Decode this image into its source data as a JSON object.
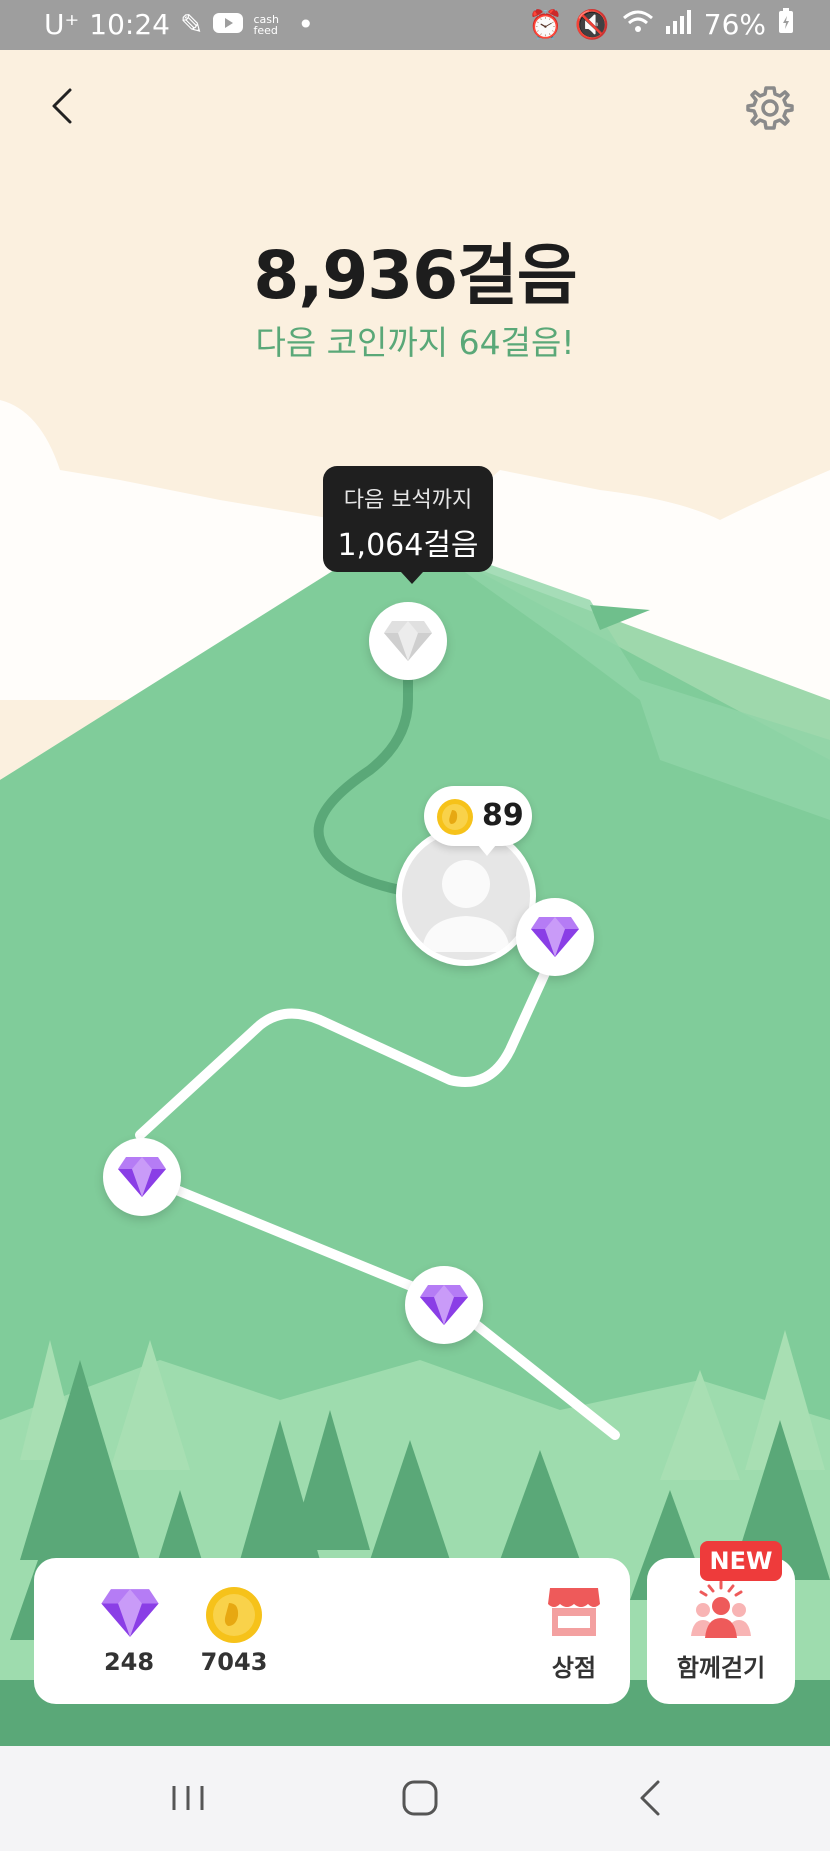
{
  "status_bar": {
    "carrier": "U⁺",
    "time": "10:24",
    "cashfeed": "cash feed",
    "battery": "76%"
  },
  "header": {
    "steps": "8,936걸음",
    "next_coin": "다음 코인까지 64걸음!"
  },
  "map": {
    "tooltip_line1": "다음 보석까지",
    "tooltip_line2": "1,064걸음",
    "coin_bubble_value": "89"
  },
  "bottom": {
    "gem_count": "248",
    "coin_count": "7043",
    "shop_label": "상점",
    "together_label": "함께걷기",
    "new_badge": "NEW"
  },
  "colors": {
    "sky": "#fbf0df",
    "mountain": "#80cc9a",
    "path": "#ffffff",
    "accent_text": "#5aa878",
    "gem": "#9a4ff0",
    "new_badge": "#ee3b3b"
  }
}
